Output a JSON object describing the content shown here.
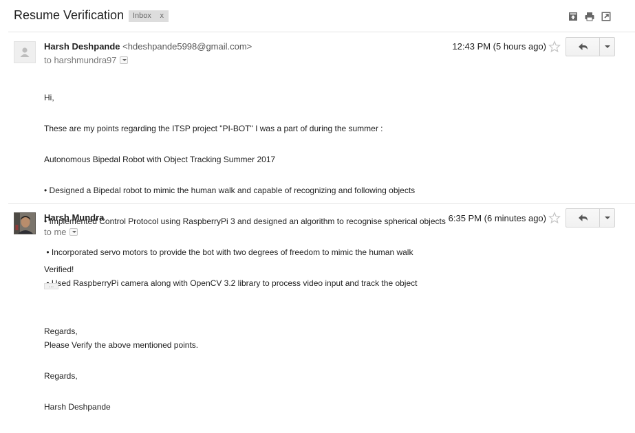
{
  "thread": {
    "subject": "Resume Verification",
    "label": "Inbox",
    "label_remove": "x",
    "actions": [
      {
        "icon": "archive-icon"
      },
      {
        "icon": "print-icon"
      },
      {
        "icon": "new-window-icon"
      }
    ]
  },
  "messages": [
    {
      "sender_name": "Harsh Deshpande",
      "sender_email": "<hdeshpande5998@gmail.com>",
      "recipient": "to harshmundra97",
      "time": "12:43 PM (5 hours ago)",
      "avatar": "default-avatar-icon",
      "body": [
        "Hi,",
        "These are my points regarding the ITSP project \"PI-BOT\" I was a part of during the summer :",
        "Autonomous Bipedal Robot with Object Tracking Summer 2017",
        "• Designed a Bipedal robot to mimic the human walk and capable of recognizing and following objects",
        "• Implemented Control Protocol using RaspberryPi 3 and designed an algorithm to recognise spherical objects",
        " • Incorporated servo motors to provide the bot with two degrees of freedom to mimic the human walk",
        " • Used RaspberryPi camera along with OpenCV 3.2 library to process video input and track the object",
        "",
        "Please Verify the above mentioned points.",
        "Regards,",
        "Harsh Deshpande"
      ]
    },
    {
      "sender_name": "Harsh Mundra",
      "recipient": "to me",
      "time": "6:35 PM (6 minutes ago)",
      "avatar": "profile-photo",
      "body": [
        "Verified!",
        "",
        "Regards,"
      ],
      "trimmed_content": "..."
    }
  ],
  "colors": {
    "divider": "#e5e5e5",
    "label_bg": "#dddddd",
    "button_border": "#d4d4d4"
  }
}
